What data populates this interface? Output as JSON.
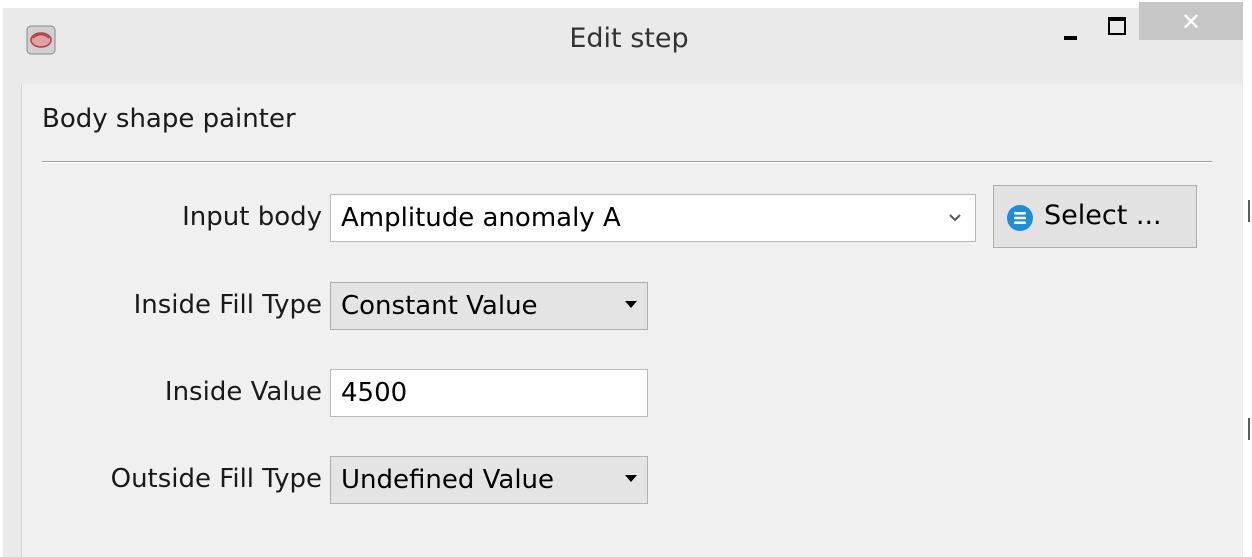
{
  "window": {
    "title": "Edit step",
    "close_glyph": "✕"
  },
  "panel": {
    "section_title": "Body shape painter"
  },
  "form": {
    "input_body": {
      "label": "Input body",
      "value": "Amplitude anomaly A",
      "select_button": "Select ..."
    },
    "inside_fill_type": {
      "label": "Inside Fill Type",
      "value": "Constant Value"
    },
    "inside_value": {
      "label": "Inside Value",
      "value": "4500"
    },
    "outside_fill_type": {
      "label": "Outside Fill Type",
      "value": "Undefined Value"
    }
  },
  "colors": {
    "close_button_bg": "#c7c7c7",
    "select_icon": "#1e8ed8"
  },
  "icons": {
    "app": "app-icon",
    "minimize": "minimize-icon",
    "maximize": "maximize-icon",
    "close": "close-icon",
    "chevron": "chevron-down-icon",
    "select": "list-circle-icon"
  }
}
